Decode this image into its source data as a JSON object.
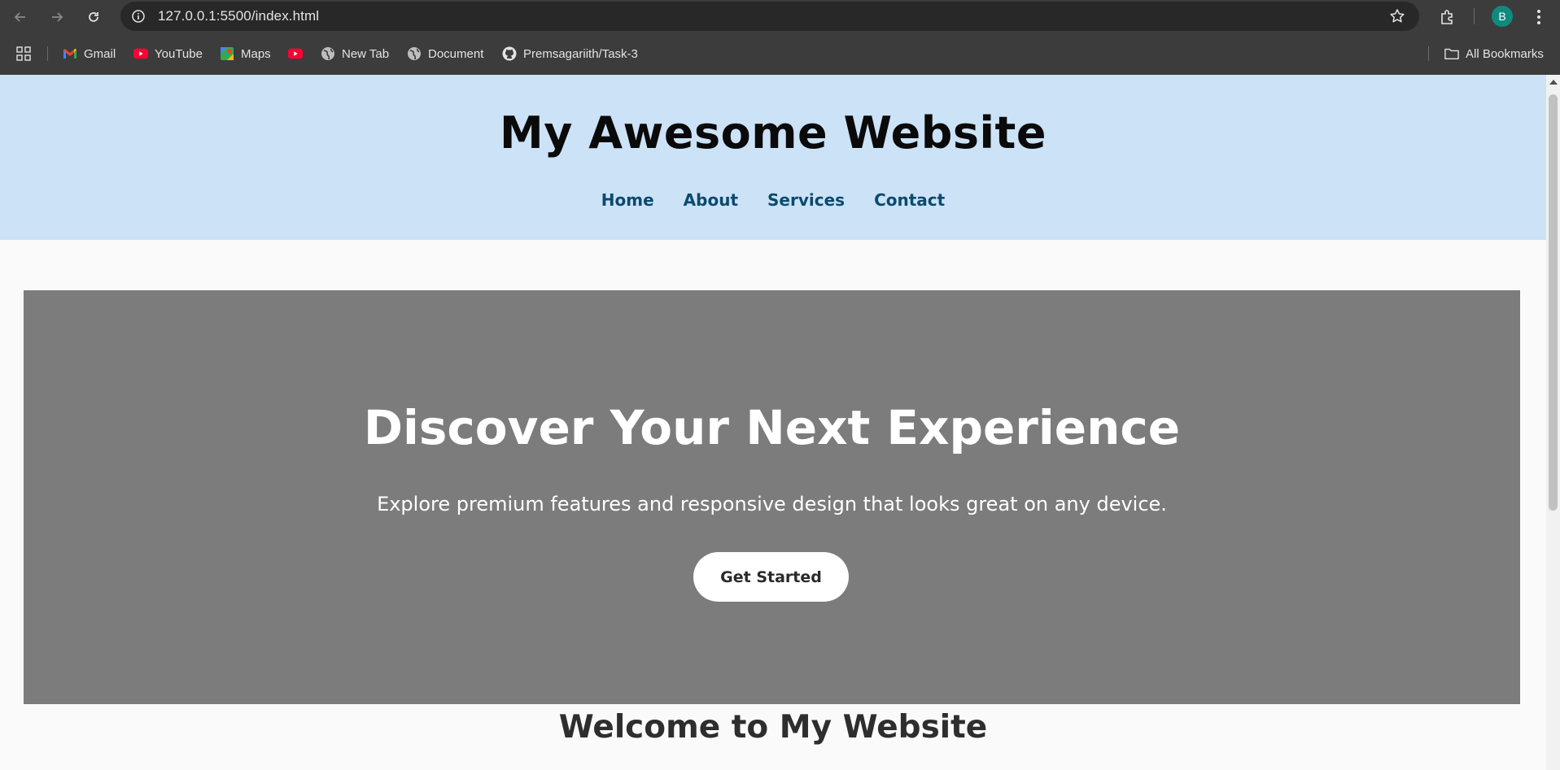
{
  "browser": {
    "url": "127.0.0.1:5500/index.html",
    "profile_initial": "B",
    "bookmarks": [
      {
        "label": "Gmail",
        "icon": "gmail-icon"
      },
      {
        "label": "YouTube",
        "icon": "youtube-icon"
      },
      {
        "label": "Maps",
        "icon": "maps-icon"
      },
      {
        "label": "",
        "icon": "youtube-icon"
      },
      {
        "label": "New Tab",
        "icon": "globe-icon"
      },
      {
        "label": "Document",
        "icon": "globe-icon"
      },
      {
        "label": "Premsagariith/Task-3",
        "icon": "github-icon"
      }
    ],
    "all_bookmarks_label": "All Bookmarks",
    "colors": {
      "chrome": "#3c3c3c",
      "omnibox": "#282828",
      "avatar": "#0f8a7e"
    }
  },
  "site": {
    "title": "My Awesome Website",
    "nav": [
      "Home",
      "About",
      "Services",
      "Contact"
    ],
    "hero": {
      "title": "Discover Your Next Experience",
      "subtitle": "Explore premium features and responsive design that looks great on any device.",
      "cta": "Get Started"
    },
    "welcome_heading": "Welcome to My Website",
    "colors": {
      "header_bg": "#cce2f6",
      "nav_link": "#0c4a6e",
      "hero_bg": "#7c7c7c"
    }
  }
}
